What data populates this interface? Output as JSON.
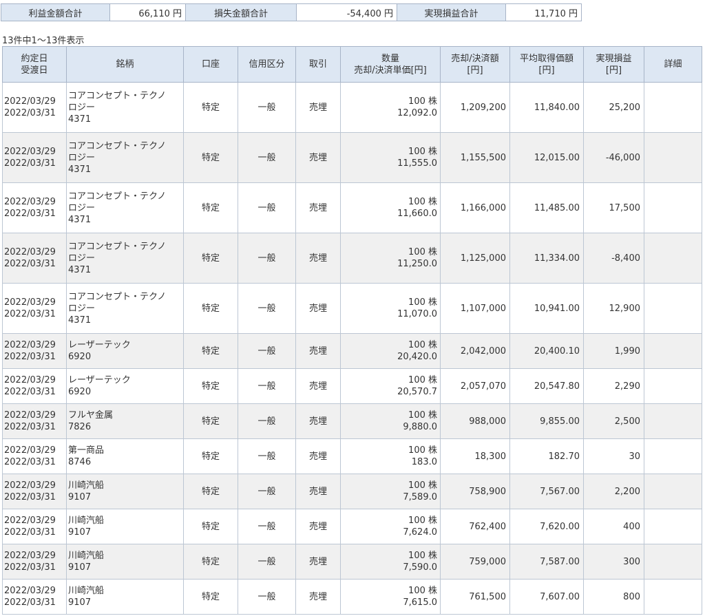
{
  "summary": [
    {
      "label": "利益金額合計",
      "value": "66,110 円"
    },
    {
      "label": "損失金額合計",
      "value": "-54,400 円"
    },
    {
      "label": "実現損益合計",
      "value": "11,710 円"
    }
  ],
  "count_text": "13件中1～13件表示",
  "headers": {
    "date1": "約定日",
    "date2": "受渡日",
    "name": "銘柄",
    "account": "口座",
    "credit": "信用区分",
    "trade": "取引",
    "qty1": "数量",
    "qty2": "売却/決済単価[円]",
    "amt1": "売却/決済額",
    "amt2": "[円]",
    "avg1": "平均取得価額",
    "avg2": "[円]",
    "pl1": "実現損益",
    "pl2": "[円]",
    "detail": "詳細"
  },
  "rows": [
    {
      "trade_date": "2022/03/29",
      "settle_date": "2022/03/31",
      "name": "コアコンセプト・テクノロジー",
      "code": "4371",
      "account": "特定",
      "credit": "一般",
      "trade": "売埋",
      "qty": "100 株",
      "price": "12,092.0",
      "amount": "1,209,200",
      "avg_cost": "11,840.00",
      "pl": "25,200"
    },
    {
      "trade_date": "2022/03/29",
      "settle_date": "2022/03/31",
      "name": "コアコンセプト・テクノロジー",
      "code": "4371",
      "account": "特定",
      "credit": "一般",
      "trade": "売埋",
      "qty": "100 株",
      "price": "11,555.0",
      "amount": "1,155,500",
      "avg_cost": "12,015.00",
      "pl": "-46,000"
    },
    {
      "trade_date": "2022/03/29",
      "settle_date": "2022/03/31",
      "name": "コアコンセプト・テクノロジー",
      "code": "4371",
      "account": "特定",
      "credit": "一般",
      "trade": "売埋",
      "qty": "100 株",
      "price": "11,660.0",
      "amount": "1,166,000",
      "avg_cost": "11,485.00",
      "pl": "17,500"
    },
    {
      "trade_date": "2022/03/29",
      "settle_date": "2022/03/31",
      "name": "コアコンセプト・テクノロジー",
      "code": "4371",
      "account": "特定",
      "credit": "一般",
      "trade": "売埋",
      "qty": "100 株",
      "price": "11,250.0",
      "amount": "1,125,000",
      "avg_cost": "11,334.00",
      "pl": "-8,400"
    },
    {
      "trade_date": "2022/03/29",
      "settle_date": "2022/03/31",
      "name": "コアコンセプト・テクノロジー",
      "code": "4371",
      "account": "特定",
      "credit": "一般",
      "trade": "売埋",
      "qty": "100 株",
      "price": "11,070.0",
      "amount": "1,107,000",
      "avg_cost": "10,941.00",
      "pl": "12,900"
    },
    {
      "trade_date": "2022/03/29",
      "settle_date": "2022/03/31",
      "name": "レーザーテック",
      "code": "6920",
      "account": "特定",
      "credit": "一般",
      "trade": "売埋",
      "qty": "100 株",
      "price": "20,420.0",
      "amount": "2,042,000",
      "avg_cost": "20,400.10",
      "pl": "1,990"
    },
    {
      "trade_date": "2022/03/29",
      "settle_date": "2022/03/31",
      "name": "レーザーテック",
      "code": "6920",
      "account": "特定",
      "credit": "一般",
      "trade": "売埋",
      "qty": "100 株",
      "price": "20,570.7",
      "amount": "2,057,070",
      "avg_cost": "20,547.80",
      "pl": "2,290"
    },
    {
      "trade_date": "2022/03/29",
      "settle_date": "2022/03/31",
      "name": "フルヤ金属",
      "code": "7826",
      "account": "特定",
      "credit": "一般",
      "trade": "売埋",
      "qty": "100 株",
      "price": "9,880.0",
      "amount": "988,000",
      "avg_cost": "9,855.00",
      "pl": "2,500"
    },
    {
      "trade_date": "2022/03/29",
      "settle_date": "2022/03/31",
      "name": "第一商品",
      "code": "8746",
      "account": "特定",
      "credit": "一般",
      "trade": "売埋",
      "qty": "100 株",
      "price": "183.0",
      "amount": "18,300",
      "avg_cost": "182.70",
      "pl": "30"
    },
    {
      "trade_date": "2022/03/29",
      "settle_date": "2022/03/31",
      "name": "川崎汽船",
      "code": "9107",
      "account": "特定",
      "credit": "一般",
      "trade": "売埋",
      "qty": "100 株",
      "price": "7,589.0",
      "amount": "758,900",
      "avg_cost": "7,567.00",
      "pl": "2,200"
    },
    {
      "trade_date": "2022/03/29",
      "settle_date": "2022/03/31",
      "name": "川崎汽船",
      "code": "9107",
      "account": "特定",
      "credit": "一般",
      "trade": "売埋",
      "qty": "100 株",
      "price": "7,624.0",
      "amount": "762,400",
      "avg_cost": "7,620.00",
      "pl": "400"
    },
    {
      "trade_date": "2022/03/29",
      "settle_date": "2022/03/31",
      "name": "川崎汽船",
      "code": "9107",
      "account": "特定",
      "credit": "一般",
      "trade": "売埋",
      "qty": "100 株",
      "price": "7,590.0",
      "amount": "759,000",
      "avg_cost": "7,587.00",
      "pl": "300"
    },
    {
      "trade_date": "2022/03/29",
      "settle_date": "2022/03/31",
      "name": "川崎汽船",
      "code": "9107",
      "account": "特定",
      "credit": "一般",
      "trade": "売埋",
      "qty": "100 株",
      "price": "7,615.0",
      "amount": "761,500",
      "avg_cost": "7,607.00",
      "pl": "800"
    }
  ]
}
